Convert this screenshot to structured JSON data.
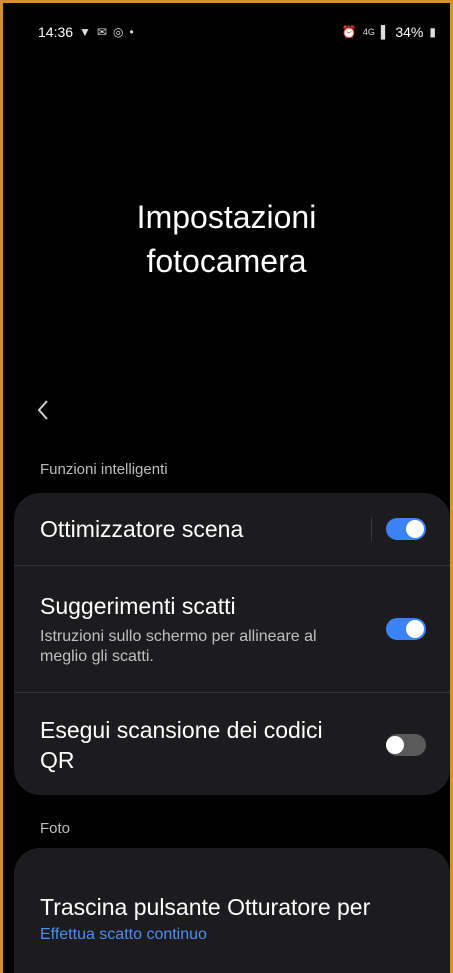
{
  "status_bar": {
    "time": "14:36",
    "left_icons": [
      "location-icon",
      "mail-icon",
      "target-icon",
      "dot-icon"
    ],
    "right_text": "34%",
    "right_icons": [
      "alarm-icon",
      "4g-icon",
      "signal-icon",
      "battery-icon"
    ]
  },
  "page": {
    "title_line1": "Impostazioni",
    "title_line2": "fotocamera"
  },
  "sections": {
    "smart": {
      "label": "Funzioni intelligenti",
      "items": [
        {
          "title": "Ottimizzatore scena",
          "enabled": true
        },
        {
          "title": "Suggerimenti scatti",
          "subtitle": "Istruzioni sullo schermo per allineare al meglio gli scatti.",
          "enabled": true
        },
        {
          "title": "Esegui scansione dei codici QR",
          "enabled": false
        }
      ]
    },
    "photo": {
      "label": "Foto",
      "items": [
        {
          "title": "Trascina pulsante Otturatore per",
          "value": "Effettua scatto continuo"
        }
      ]
    }
  },
  "colors": {
    "accent": "#3b82f6",
    "link": "#4f8df0",
    "card": "#1c1c1e",
    "background": "#000000",
    "frame": "#d9902a"
  }
}
